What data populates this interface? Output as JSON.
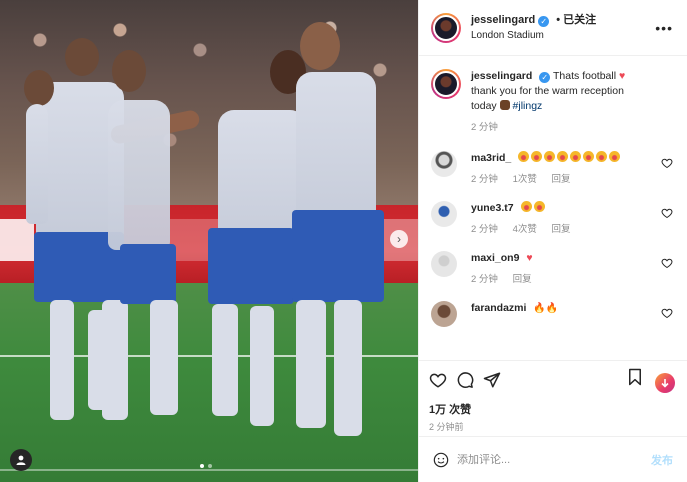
{
  "header": {
    "username": "jesselingard",
    "follow_label": "• 已关注",
    "location": "London Stadium",
    "more_label": "•••"
  },
  "caption": {
    "username": "jesselingard",
    "text": "Thats football",
    "text2": "thank you for the warm reception today",
    "hashtag": "#jlingz",
    "time": "2 分钟"
  },
  "comments": [
    {
      "username": "ma3rid_",
      "text": "",
      "time": "2 分钟",
      "likes": "1次赞",
      "reply": "回复"
    },
    {
      "username": "yune3.t7",
      "text": "",
      "time": "2 分钟",
      "likes": "4次赞",
      "reply": "回复"
    },
    {
      "username": "maxi_on9",
      "text": "",
      "time": "2 分钟",
      "likes": "",
      "reply": "回复"
    },
    {
      "username": "farandazmi",
      "text": "",
      "time": "",
      "likes": "",
      "reply": ""
    }
  ],
  "post": {
    "likes": "1万 次赞",
    "time": "2 分钟前"
  },
  "comment_box": {
    "placeholder": "添加评论...",
    "post_label": "发布"
  },
  "colors": {
    "accent": "#3897f0",
    "heart": "#ed4956",
    "muted": "#8e8e8e",
    "post_disabled": "#b2dffc"
  },
  "icons": [
    "heart-icon",
    "comment-icon",
    "share-icon",
    "bookmark-icon",
    "emoji-icon",
    "more-icon",
    "verified-icon"
  ]
}
